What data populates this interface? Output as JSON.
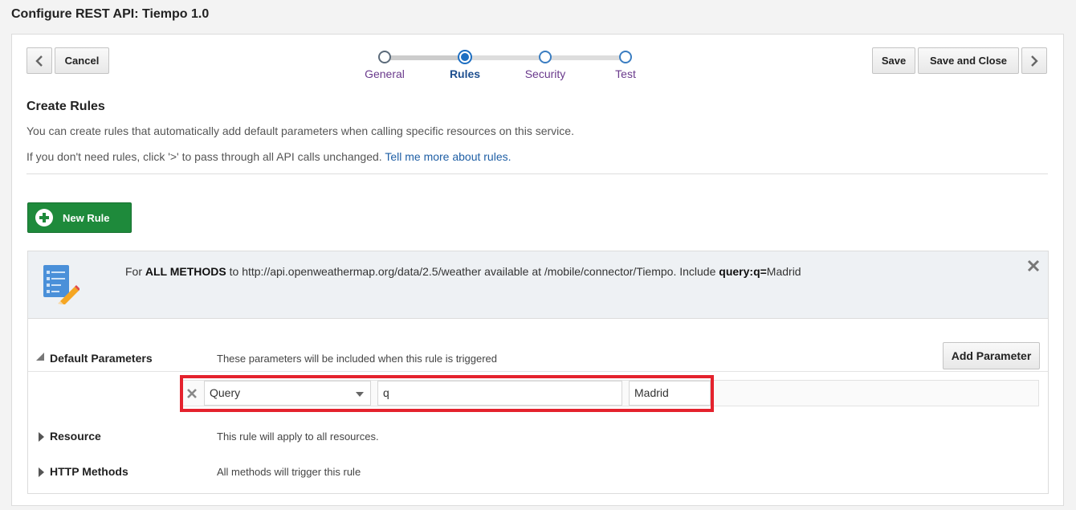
{
  "page": {
    "title": "Configure REST API: Tiempo 1.0"
  },
  "toolbar": {
    "cancel_label": "Cancel",
    "save_label": "Save",
    "save_close_label": "Save and Close"
  },
  "train": {
    "steps": [
      {
        "label": "General",
        "state": "visited"
      },
      {
        "label": "Rules",
        "state": "current"
      },
      {
        "label": "Security",
        "state": "unvisited"
      },
      {
        "label": "Test",
        "state": "unvisited"
      }
    ]
  },
  "create_rules": {
    "title": "Create Rules",
    "desc1": "You can create rules that automatically add default parameters when calling specific resources on this service.",
    "desc2_prefix": "If you don't need rules, click '>' to pass through all API calls unchanged.",
    "desc2_link": "Tell me more about rules."
  },
  "new_rule": {
    "label": "New Rule"
  },
  "rule": {
    "summary": {
      "prefix": "For",
      "methods": "ALL METHODS",
      "to": "to http://api.openweathermap.org/data/2.5/weather available at /mobile/connector/Tiempo. Include",
      "param": "query:q=",
      "value": "Madrid"
    },
    "default_params": {
      "label": "Default Parameters",
      "desc": "These parameters will be included when this rule is triggered",
      "add_label": "Add Parameter",
      "rows": [
        {
          "type": "Query",
          "name": "q",
          "value": "Madrid"
        }
      ]
    },
    "resource": {
      "label": "Resource",
      "desc": "This rule will apply to all resources."
    },
    "http_methods": {
      "label": "HTTP Methods",
      "desc": "All methods will trigger this rule"
    }
  },
  "colors": {
    "primary_green": "#1e8a3b",
    "accent_blue": "#1e6fc2",
    "highlight_red": "#e4222d"
  }
}
